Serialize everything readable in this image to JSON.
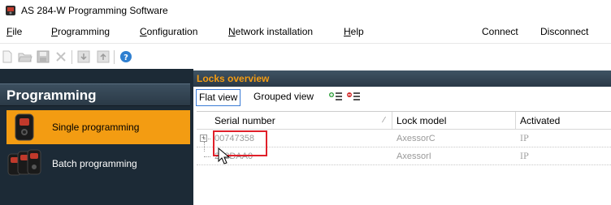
{
  "window": {
    "title": "AS 284-W Programming Software",
    "icon": "app-lock-icon"
  },
  "menu": {
    "file": {
      "label": "File",
      "accel": "F",
      "rest": "ile"
    },
    "programming": {
      "label": "Programming",
      "accel": "P",
      "rest": "rogramming"
    },
    "configuration": {
      "label": "Configuration",
      "accel": "C",
      "rest": "onfiguration"
    },
    "network": {
      "label": "Network installation",
      "accel": "N",
      "rest": "etwork installation"
    },
    "help": {
      "label": "Help",
      "accel": "H",
      "rest": "elp"
    },
    "connect": "Connect",
    "disconnect": "Disconnect"
  },
  "toolbar": {
    "buttons": [
      "new-icon",
      "open-icon",
      "save-icon",
      "delete-icon",
      "import-icon",
      "export-icon",
      "help-icon"
    ]
  },
  "sidebar": {
    "title": "Programming",
    "items": [
      {
        "label": "Single programming",
        "icon": "single-lock-icon",
        "active": true
      },
      {
        "label": "Batch programming",
        "icon": "batch-locks-icon",
        "active": false
      }
    ]
  },
  "locks": {
    "title": "Locks overview",
    "views": {
      "flat": "Flat view",
      "grouped": "Grouped view"
    },
    "columns": {
      "serial": "Serial number",
      "model": "Lock model",
      "activated": "Activated"
    },
    "rows": [
      {
        "serial": "00747358",
        "model": "AxessorC",
        "activated": "IP"
      },
      {
        "serial": "252DAA0",
        "model": "AxessorI",
        "activated": "IP"
      }
    ]
  },
  "colors": {
    "accent": "#f39c12",
    "sidebar_bg": "#1c2a36",
    "highlight": "#e0202a"
  }
}
